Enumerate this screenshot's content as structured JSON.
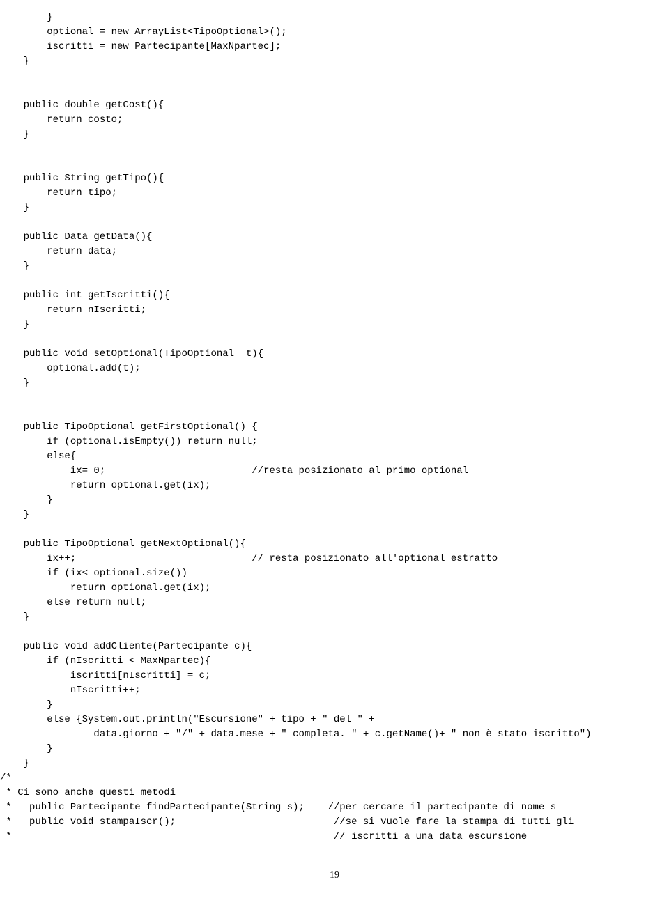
{
  "code_lines": [
    "        }",
    "        optional = new ArrayList<TipoOptional>();",
    "        iscritti = new Partecipante[MaxNpartec];",
    "    }",
    "",
    "",
    "    public double getCost(){",
    "        return costo;",
    "    }",
    "",
    "",
    "    public String getTipo(){",
    "        return tipo;",
    "    }",
    "",
    "    public Data getData(){",
    "        return data;",
    "    }",
    "",
    "    public int getIscritti(){",
    "        return nIscritti;",
    "    }",
    "",
    "    public void setOptional(TipoOptional  t){",
    "        optional.add(t);",
    "    }",
    "",
    "",
    "    public TipoOptional getFirstOptional() {",
    "        if (optional.isEmpty()) return null;",
    "        else{",
    "            ix= 0;                         //resta posizionato al primo optional",
    "            return optional.get(ix);",
    "        }",
    "    }",
    "",
    "    public TipoOptional getNextOptional(){",
    "        ix++;                              // resta posizionato all'optional estratto",
    "        if (ix< optional.size())",
    "            return optional.get(ix);",
    "        else return null;",
    "    }",
    "",
    "    public void addCliente(Partecipante c){",
    "        if (nIscritti < MaxNpartec){",
    "            iscritti[nIscritti] = c;",
    "            nIscritti++;",
    "        }",
    "        else {System.out.println(\"Escursione\" + tipo + \" del \" +",
    "                data.giorno + \"/\" + data.mese + \" completa. \" + c.getName()+ \" non è stato iscritto\")",
    "        }",
    "    }",
    "/*",
    " * Ci sono anche questi metodi",
    " *   public Partecipante findPartecipante(String s);    //per cercare il partecipante di nome s",
    " *   public void stampaIscr();                           //se si vuole fare la stampa di tutti gli",
    " *                                                       // iscritti a una data escursione"
  ],
  "page_number": "19"
}
